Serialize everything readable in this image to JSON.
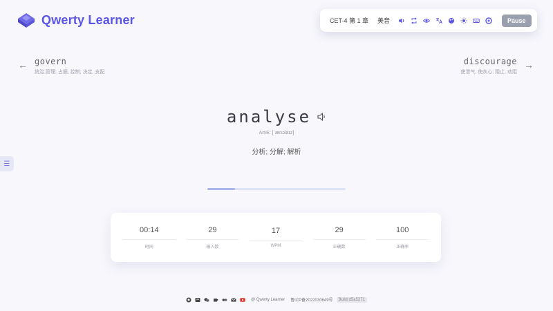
{
  "app": {
    "title": "Qwerty Learner"
  },
  "toolbar": {
    "dictionary": "CET-4 第 1 章",
    "accent": "美音",
    "icons": [
      "volume-icon",
      "loop-icon",
      "eye-icon",
      "translate-icon",
      "theme-icon",
      "sun-icon",
      "keyboard-icon",
      "info-icon"
    ],
    "pause_label": "Pause",
    "accent_color": "#5b55e3"
  },
  "prev_word": {
    "word": "govern",
    "translation": "统治,管理; 占据, 控制; 决定, 支配"
  },
  "next_word": {
    "word": "discourage",
    "translation": "使泄气, 使灰心; 阻止, 劝阻"
  },
  "current": {
    "word": "analyse",
    "phonetic": "AmE: [ˈænəlaɪz]",
    "translation": "分析; 分解; 解析"
  },
  "progress": {
    "fraction": 0.2
  },
  "stats": [
    {
      "value": "00:14",
      "label": "时间"
    },
    {
      "value": "29",
      "label": "输入数"
    },
    {
      "value": "17",
      "label": "WPM"
    },
    {
      "value": "29",
      "label": "正确数"
    },
    {
      "value": "100",
      "label": "正确率"
    }
  ],
  "footer": {
    "copyright": "@ Qwerty Learner",
    "icp": "鲁ICP备2022030649号",
    "build": "Build d5a5271"
  }
}
